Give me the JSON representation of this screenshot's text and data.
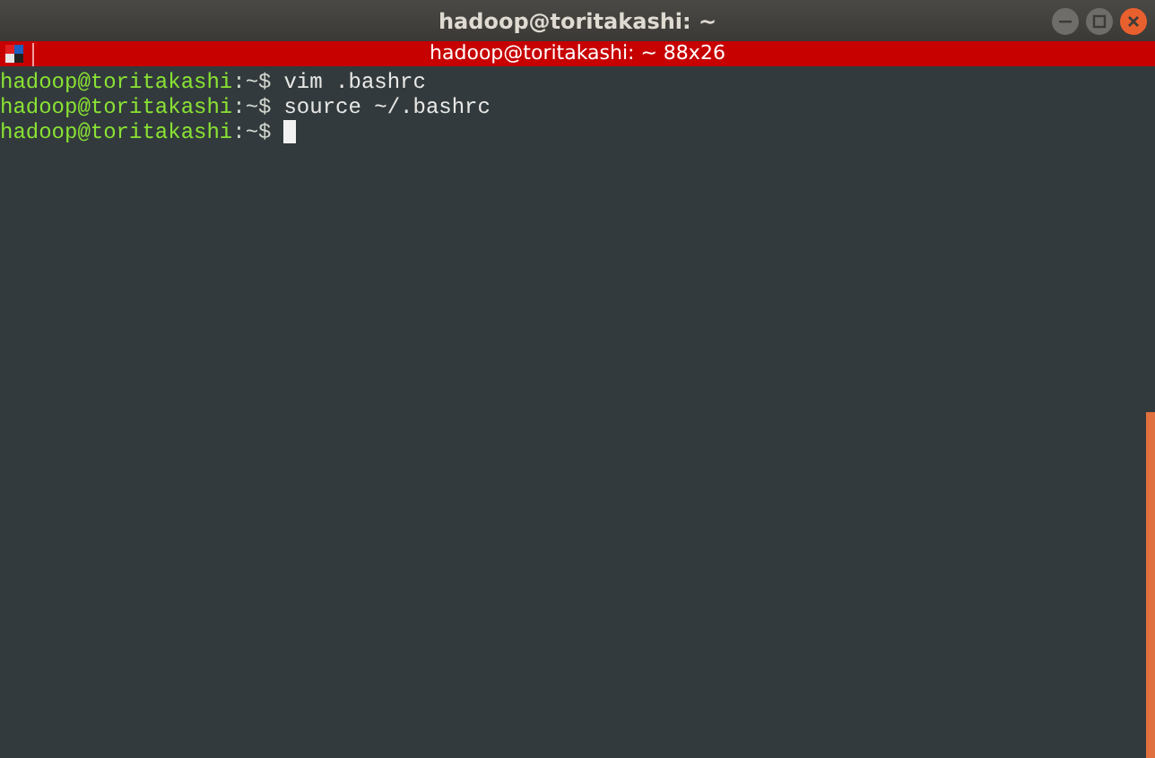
{
  "window": {
    "title": "hadoop@toritakashi: ~"
  },
  "terminal_bar": {
    "title": "hadoop@toritakashi: ~ 88x26"
  },
  "lines": [
    {
      "prompt": "hadoop@toritakashi",
      "path": ":~$",
      "command": "vim .bashrc",
      "cursor": false
    },
    {
      "prompt": "hadoop@toritakashi",
      "path": ":~$",
      "command": "source ~/.bashrc",
      "cursor": false
    },
    {
      "prompt": "hadoop@toritakashi",
      "path": ":~$",
      "cursor": true
    }
  ]
}
